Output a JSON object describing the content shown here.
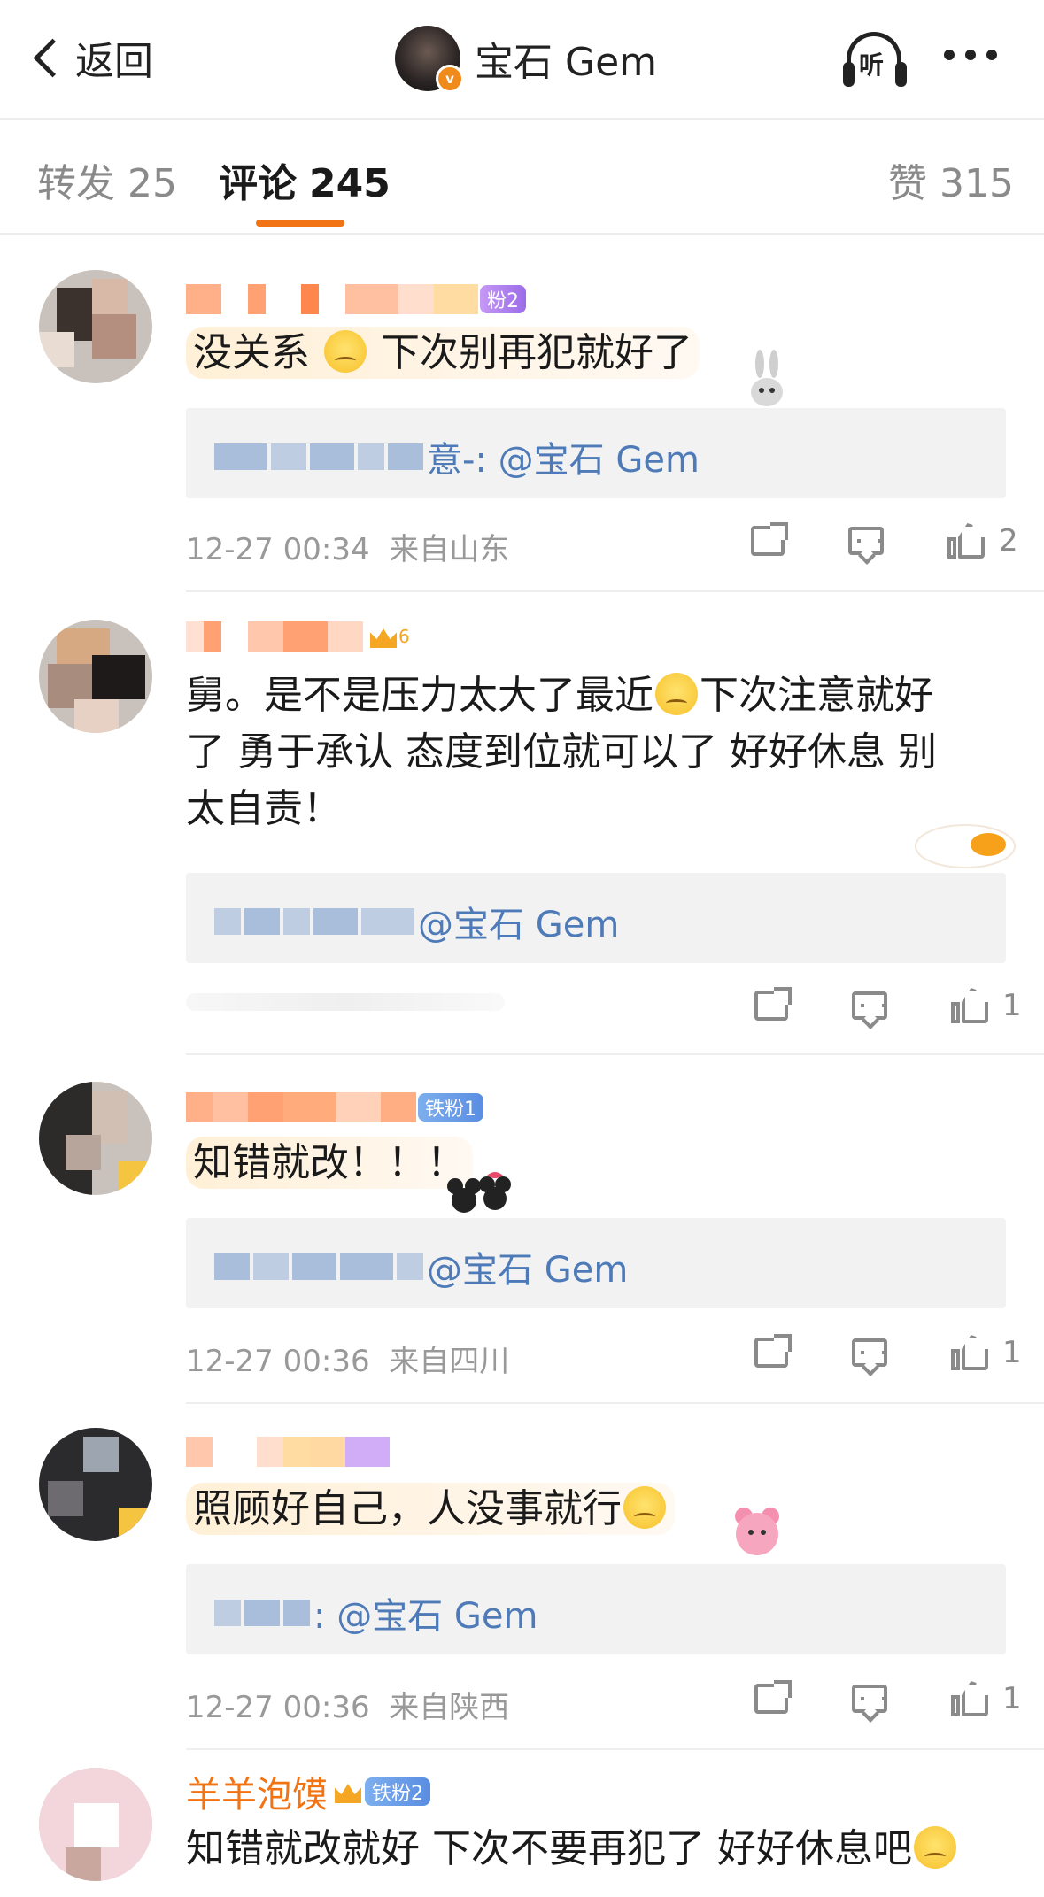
{
  "nav": {
    "back_label": "返回",
    "title": "宝石 Gem",
    "verified_mark": "v",
    "listen_label": "听"
  },
  "tabs": [
    {
      "label": "转发",
      "count": "25"
    },
    {
      "label": "评论",
      "count": "245"
    },
    {
      "label": "赞",
      "count": "315"
    }
  ],
  "accent_color": "#f27313",
  "mention_color": "#4e7bb8",
  "comments": [
    {
      "fan_badge": "粉2",
      "text": "没关系",
      "text2": "下次别再犯就好了",
      "reply": "意-: @宝石 Gem",
      "time": "12-27 00:34",
      "location": "来自山东",
      "likes": "2"
    },
    {
      "fan_badge": "6",
      "text_line1a": "舅。是不是压力太大了最近",
      "text_line1b": "下次注意就好",
      "text_line2": "了 勇于承认 态度到位就可以了 好好休息 别",
      "text_line3": "太自责！",
      "reply": "@宝石 Gem",
      "likes": "1"
    },
    {
      "fan_badge": "铁粉1",
      "text": "知错就改！！！",
      "reply": "@宝石 Gem",
      "time": "12-27 00:36",
      "location": "来自四川",
      "likes": "1"
    },
    {
      "text": "照顾好自己，人没事就行",
      "reply": ": @宝石 Gem",
      "time": "12-27 00:36",
      "location": "来自陕西",
      "likes": "1"
    },
    {
      "name": "羊羊泡馍",
      "fan_badge": "铁粉2",
      "text": "知错就改就好 下次不要再犯了 好好休息吧"
    }
  ]
}
